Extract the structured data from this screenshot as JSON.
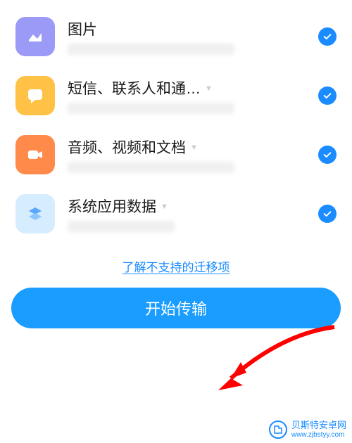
{
  "items": [
    {
      "title": "图片",
      "hasChevron": false,
      "iconColorClass": "icon-purple",
      "iconName": "image-icon",
      "subClass": "item-sub",
      "checked": true
    },
    {
      "title": "短信、联系人和通…",
      "hasChevron": true,
      "iconColorClass": "icon-yellow",
      "iconName": "message-icon",
      "subClass": "item-sub",
      "checked": true
    },
    {
      "title": "音频、视频和文档",
      "hasChevron": true,
      "iconColorClass": "icon-orange",
      "iconName": "video-icon",
      "subClass": "item-sub",
      "checked": true
    },
    {
      "title": "系统应用数据",
      "hasChevron": true,
      "iconColorClass": "icon-lightblue",
      "iconName": "layers-icon",
      "subClass": "item-sub short",
      "checked": true
    }
  ],
  "link": {
    "label": "了解不支持的迁移项"
  },
  "button": {
    "label": "开始传输"
  },
  "watermark": {
    "title": "贝斯特安卓网",
    "url": "www.zjbstyy.com"
  },
  "colors": {
    "primary": "#1a8cff",
    "buttonBg": "#1a9dff",
    "arrow": "#ff0000"
  }
}
